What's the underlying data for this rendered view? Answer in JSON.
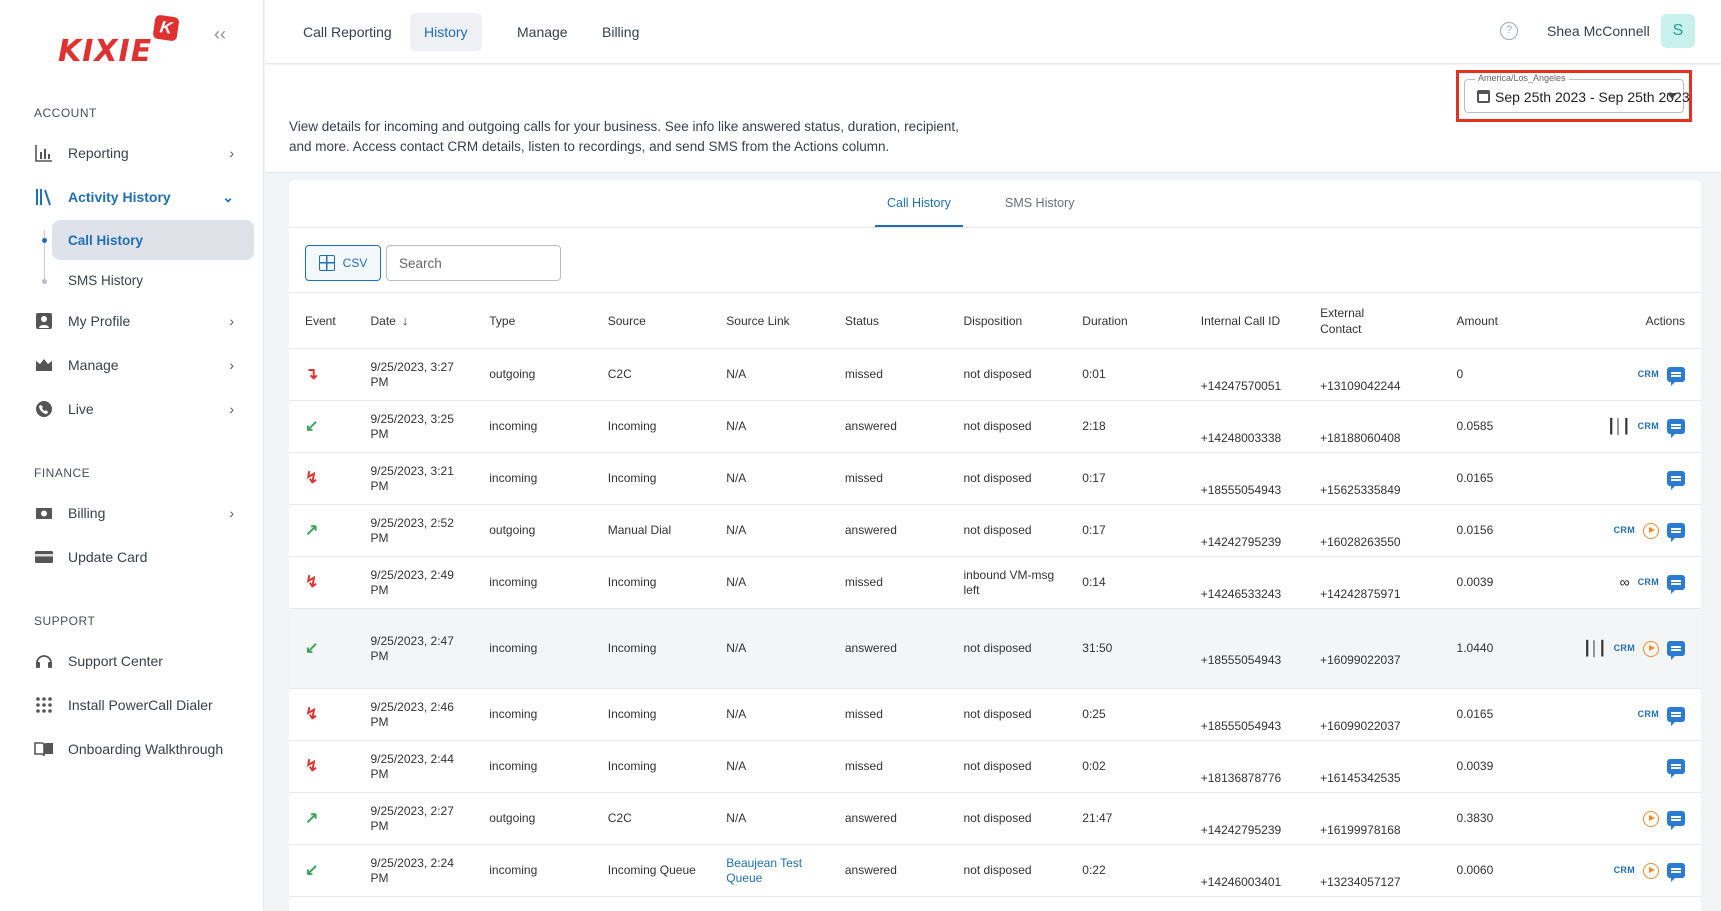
{
  "logo": {
    "text": "KIXIE",
    "badge": "K"
  },
  "sidebar": {
    "sections": {
      "account": "ACCOUNT",
      "finance": "FINANCE",
      "support": "SUPPORT"
    },
    "items": {
      "reporting": "Reporting",
      "activity_history": "Activity History",
      "call_history": "Call History",
      "sms_history": "SMS History",
      "my_profile": "My Profile",
      "manage": "Manage",
      "live": "Live",
      "billing": "Billing",
      "update_card": "Update Card",
      "support_center": "Support Center",
      "install_powercall": "Install PowerCall Dialer",
      "onboarding": "Onboarding Walkthrough"
    }
  },
  "topnav": {
    "tabs": [
      "Call Reporting",
      "History",
      "Manage",
      "Billing"
    ],
    "user_name": "Shea McConnell",
    "avatar_letter": "S"
  },
  "header": {
    "description": "View details for incoming and outgoing calls for your business. See info like answered status, duration, recipient, and more. Access contact CRM details, listen to recordings, and send SMS from the Actions column.",
    "timezone": "America/Los_Angeles",
    "date_range": "Sep 25th 2023 - Sep 25th 2023"
  },
  "subtabs": [
    "Call History",
    "SMS History"
  ],
  "toolbar": {
    "csv_label": "CSV",
    "search_placeholder": "Search"
  },
  "table": {
    "columns": [
      "Event",
      "Date",
      "Type",
      "Source",
      "Source Link",
      "Status",
      "Disposition",
      "Duration",
      "Internal Call ID",
      "External Contact",
      "Amount",
      "Actions"
    ],
    "crm_label": "CRM",
    "rows": [
      {
        "event": "missed-outgoing",
        "date": "9/25/2023, 3:27 PM",
        "type": "outgoing",
        "source": "C2C",
        "source_link": "N/A",
        "status": "missed",
        "disposition": "not disposed",
        "duration": "0:01",
        "internal": "+14247570051",
        "external": "+13109042244",
        "amount": "0",
        "actions": [
          "crm",
          "sms"
        ]
      },
      {
        "event": "incoming",
        "date": "9/25/2023, 3:25 PM",
        "type": "incoming",
        "source": "Incoming",
        "source_link": "N/A",
        "status": "answered",
        "disposition": "not disposed",
        "duration": "2:18",
        "internal": "+14248003338",
        "external": "+18188060408",
        "amount": "0.0585",
        "actions": [
          "wave",
          "crm",
          "sms"
        ]
      },
      {
        "event": "missed-incoming",
        "date": "9/25/2023, 3:21 PM",
        "type": "incoming",
        "source": "Incoming",
        "source_link": "N/A",
        "status": "missed",
        "disposition": "not disposed",
        "duration": "0:17",
        "internal": "+18555054943",
        "external": "+15625335849",
        "amount": "0.0165",
        "actions": [
          "sms"
        ]
      },
      {
        "event": "outgoing",
        "date": "9/25/2023, 2:52 PM",
        "type": "outgoing",
        "source": "Manual Dial",
        "source_link": "N/A",
        "status": "answered",
        "disposition": "not disposed",
        "duration": "0:17",
        "internal": "+14242795239",
        "external": "+16028263550",
        "amount": "0.0156",
        "actions": [
          "crm",
          "play",
          "sms"
        ]
      },
      {
        "event": "missed-incoming",
        "date": "9/25/2023, 2:49 PM",
        "type": "incoming",
        "source": "Incoming",
        "source_link": "N/A",
        "status": "missed",
        "disposition": "inbound VM-msg left",
        "duration": "0:14",
        "internal": "+14246533243",
        "external": "+14242875971",
        "amount": "0.0039",
        "actions": [
          "vm",
          "crm",
          "sms"
        ]
      },
      {
        "event": "incoming",
        "date": "9/25/2023, 2:47 PM",
        "type": "incoming",
        "source": "Incoming",
        "source_link": "N/A",
        "status": "answered",
        "disposition": "not disposed",
        "duration": "31:50",
        "internal": "+18555054943",
        "external": "+16099022037",
        "amount": "1.0440",
        "actions": [
          "wave",
          "crm",
          "play",
          "sms"
        ],
        "highlight": true
      },
      {
        "event": "missed-incoming",
        "date": "9/25/2023, 2:46 PM",
        "type": "incoming",
        "source": "Incoming",
        "source_link": "N/A",
        "status": "missed",
        "disposition": "not disposed",
        "duration": "0:25",
        "internal": "+18555054943",
        "external": "+16099022037",
        "amount": "0.0165",
        "actions": [
          "crm",
          "sms"
        ]
      },
      {
        "event": "missed-incoming",
        "date": "9/25/2023, 2:44 PM",
        "type": "incoming",
        "source": "Incoming",
        "source_link": "N/A",
        "status": "missed",
        "disposition": "not disposed",
        "duration": "0:02",
        "internal": "+18136878776",
        "external": "+16145342535",
        "amount": "0.0039",
        "actions": [
          "sms"
        ]
      },
      {
        "event": "outgoing",
        "date": "9/25/2023, 2:27 PM",
        "type": "outgoing",
        "source": "C2C",
        "source_link": "N/A",
        "status": "answered",
        "disposition": "not disposed",
        "duration": "21:47",
        "internal": "+14242795239",
        "external": "+16199978168",
        "amount": "0.3830",
        "actions": [
          "play",
          "sms"
        ]
      },
      {
        "event": "incoming",
        "date": "9/25/2023, 2:24 PM",
        "type": "incoming",
        "source": "Incoming Queue",
        "source_link": "Beaujean Test Queue",
        "status": "answered",
        "disposition": "not disposed",
        "duration": "0:22",
        "internal": "+14246003401",
        "external": "+13234057127",
        "amount": "0.0060",
        "actions": [
          "crm",
          "play",
          "sms"
        ]
      }
    ]
  },
  "colors": {
    "accent": "#1f6fb5",
    "brand": "#e03131",
    "highlight_border": "#e2321f"
  }
}
